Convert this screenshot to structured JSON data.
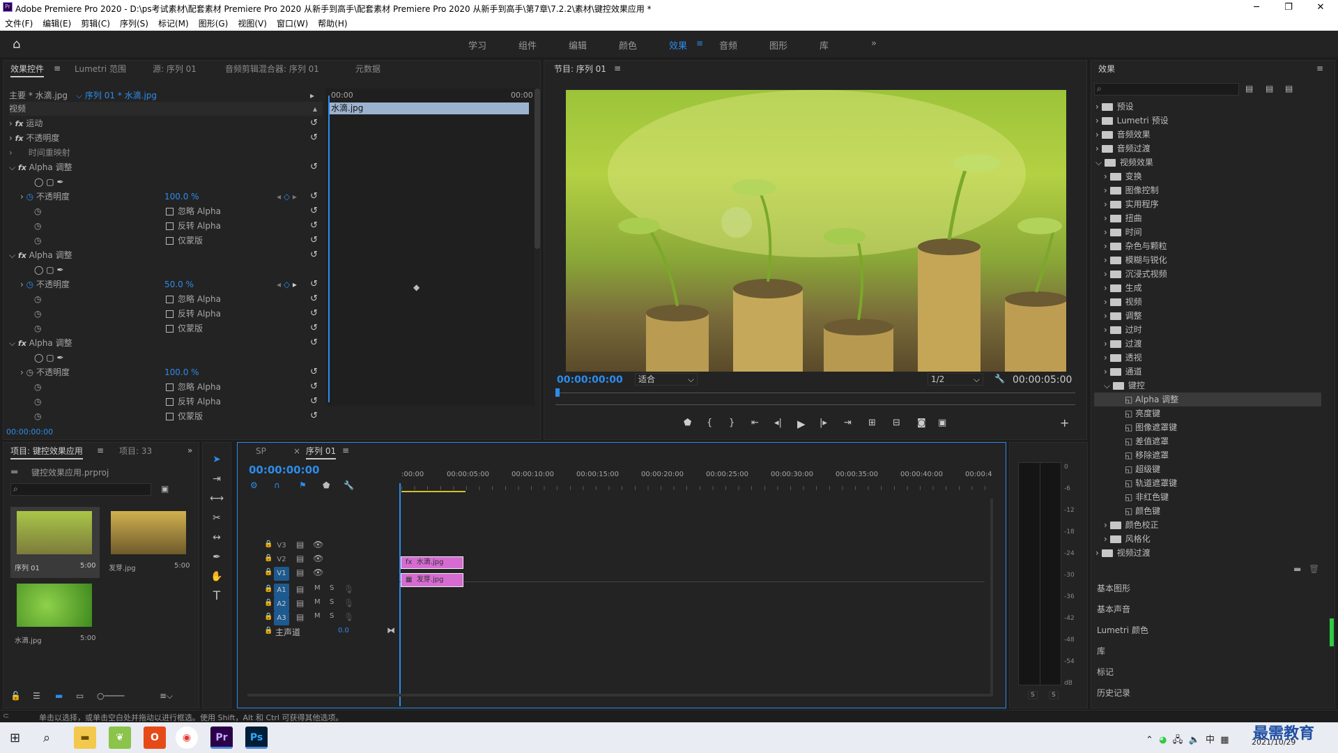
{
  "title": "Adobe Premiere Pro 2020 - D:\\ps考试素材\\配套素材 Premiere Pro 2020 从新手到高手\\配套素材 Premiere Pro 2020 从新手到高手\\第7章\\7.2.2\\素材\\键控效果应用 *",
  "menu": [
    "文件(F)",
    "编辑(E)",
    "剪辑(C)",
    "序列(S)",
    "标记(M)",
    "图形(G)",
    "视图(V)",
    "窗口(W)",
    "帮助(H)"
  ],
  "workspaces": [
    "学习",
    "组件",
    "编辑",
    "颜色",
    "效果",
    "音频",
    "图形",
    "库"
  ],
  "ec": {
    "tabs": [
      "效果控件",
      "Lumetri 范围",
      "源: 序列 01",
      "音频剪辑混合器: 序列 01",
      "元数据"
    ],
    "master": "主要 * 水滴.jpg",
    "seq": "序列 01 * 水滴.jpg",
    "video": "视频",
    "tc_start": "00:00",
    "tc_end": "00:00",
    "clip": "水滴.jpg",
    "motion": "运动",
    "opacity": "不透明度",
    "timeremap": "时间重映射",
    "alpha": "Alpha 调整",
    "ignore": "忽略 Alpha",
    "invert": "反转 Alpha",
    "mask": "仅蒙版",
    "op1": "100.0 %",
    "op2": "50.0 %",
    "op3": "100.0 %",
    "timecode": "00:00:00:00"
  },
  "program": {
    "title": "节目: 序列 01",
    "tc_left": "00:00:00:00",
    "fit": "适合",
    "res": "1/2",
    "tc_right": "00:00:05:00"
  },
  "project": {
    "tabs": [
      "项目: 键控效果应用",
      "项目: 33"
    ],
    "file": "键控效果应用.prproj",
    "items": [
      {
        "name": "序列 01",
        "dur": "5:00"
      },
      {
        "name": "发芽.jpg",
        "dur": "5:00"
      },
      {
        "name": "水滴.jpg",
        "dur": "5:00"
      }
    ]
  },
  "timeline": {
    "tabs": [
      "SP",
      "序列 01"
    ],
    "tc": "00:00:00:00",
    "ruler": [
      ":00:00",
      "00:00:05:00",
      "00:00:10:00",
      "00:00:15:00",
      "00:00:20:00",
      "00:00:25:00",
      "00:00:30:00",
      "00:00:35:00",
      "00:00:40:00",
      "00:00:4"
    ],
    "tracks": [
      "V3",
      "V2",
      "V1",
      "A1",
      "A2",
      "A3"
    ],
    "master": "主声道",
    "master_val": "0.0",
    "clip_v2": "水滴.jpg",
    "clip_v1": "发芽.jpg"
  },
  "effects": {
    "title": "效果",
    "top": [
      "预设",
      "Lumetri 预设",
      "音频效果",
      "音频过渡",
      "视频效果"
    ],
    "video": [
      "变换",
      "图像控制",
      "实用程序",
      "扭曲",
      "时间",
      "杂色与颗粒",
      "模糊与锐化",
      "沉浸式视频",
      "生成",
      "视频",
      "调整",
      "过时",
      "过渡",
      "透视",
      "通道",
      "键控"
    ],
    "keying": [
      "Alpha 调整",
      "亮度键",
      "图像遮罩键",
      "差值遮罩",
      "移除遮罩",
      "超级键",
      "轨道遮罩键",
      "非红色键",
      "颜色键"
    ],
    "after": [
      "颜色校正",
      "风格化"
    ],
    "vt": "视频过渡",
    "panels": [
      "基本图形",
      "基本声音",
      "Lumetri 颜色",
      "库",
      "标记",
      "历史记录"
    ]
  },
  "meter": {
    "ticks": [
      "0",
      "-6",
      "-12",
      "-18",
      "-24",
      "-30",
      "-36",
      "-42",
      "-48",
      "-54",
      "dB"
    ],
    "s": "S"
  },
  "status": "单击以选择，或单击空白处并拖动以进行框选。使用 Shift，Alt 和 Ctrl 可获得其他选项。",
  "taskbar": {
    "ime": "中",
    "date": "2021/10/29",
    "watermark": "最需教育"
  }
}
